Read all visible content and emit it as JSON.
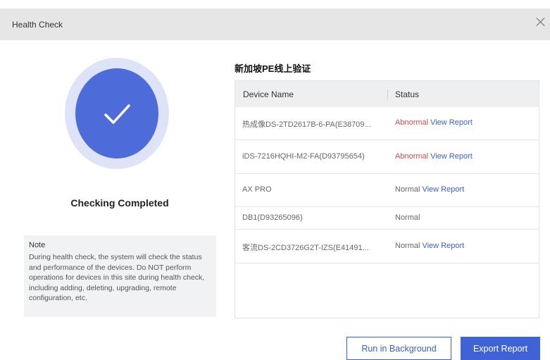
{
  "dialog": {
    "title": "Health Check"
  },
  "progress": {
    "status_text": "Checking Completed"
  },
  "note": {
    "heading": "Note",
    "body": "During health check, the system will check the status and performance of the devices. Do NOT perform operations for devices in this site during health check, including adding, deleting, upgrading, remote configuration, etc."
  },
  "site": {
    "name": "新加坡PE线上验证"
  },
  "table": {
    "headers": {
      "device_name": "Device Name",
      "status": "Status"
    },
    "rows": [
      {
        "name": "热成像DS-2TD2617B-6-PA(E38709...",
        "status": "Abnormal",
        "link": "View Report"
      },
      {
        "name": "iDS-7216HQHI-M2-FA(D93795654)",
        "status": "Abnormal",
        "link": "View Report"
      },
      {
        "name": "AX PRO",
        "status": "Normal",
        "link": "View Report"
      },
      {
        "name": "DB1(D93265096)",
        "status": "Normal",
        "link": ""
      },
      {
        "name": "客流DS-2CD3726G2T-IZS(E41491...",
        "status": "Normal",
        "link": "View Report"
      }
    ]
  },
  "buttons": {
    "run_background": "Run in Background",
    "export_report": "Export Report"
  },
  "colors": {
    "accent": "#3f63d6",
    "abnormal": "#d94a4a",
    "circle": "#4d6cd9",
    "circle_ring": "#dfe3f8"
  }
}
